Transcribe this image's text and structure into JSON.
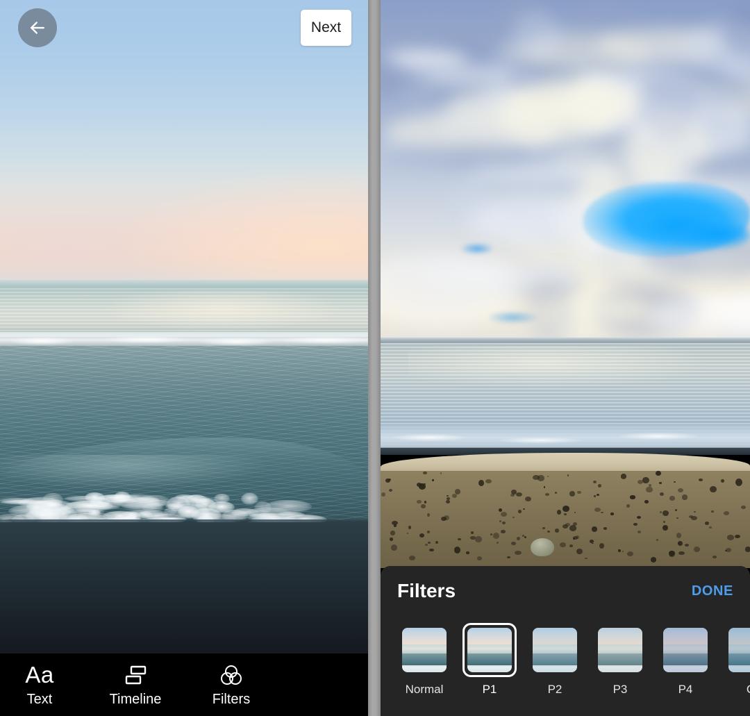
{
  "left_editor": {
    "back_button": {
      "icon": "arrow-left-icon"
    },
    "next_button_label": "Next",
    "toolbar": {
      "items": [
        {
          "label": "Text",
          "icon": "text-aa-icon",
          "glyph": "Aa"
        },
        {
          "label": "Timeline",
          "icon": "timeline-icon"
        },
        {
          "label": "Filters",
          "icon": "filters-circles-icon"
        }
      ]
    }
  },
  "right_editor": {
    "filters_panel": {
      "title": "Filters",
      "done_label": "DONE",
      "selected_filter": "P1",
      "filters": [
        {
          "label": "Normal",
          "selected": false
        },
        {
          "label": "P1",
          "selected": true
        },
        {
          "label": "P2",
          "selected": false
        },
        {
          "label": "P3",
          "selected": false
        },
        {
          "label": "P4",
          "selected": false
        },
        {
          "label": "C",
          "selected": false
        }
      ]
    }
  },
  "colors": {
    "accent_done": "#4c9eeb",
    "toolbar_bg": "#000000",
    "sheet_bg": "#252525",
    "next_bg": "#ffffff",
    "selection_ring": "#ffffff"
  }
}
